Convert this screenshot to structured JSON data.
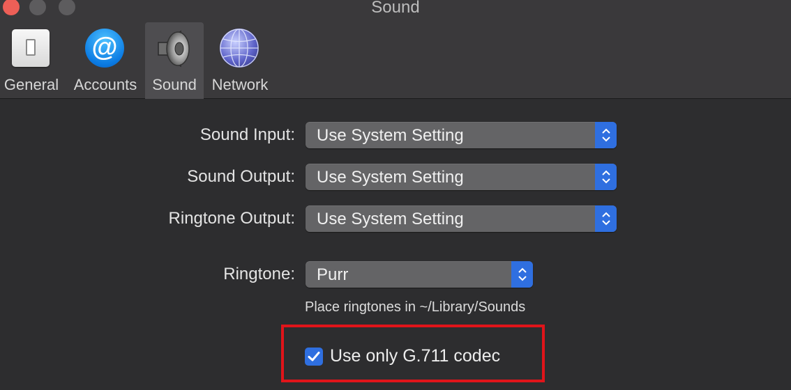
{
  "window": {
    "title": "Sound"
  },
  "toolbar": {
    "items": [
      {
        "label": "General",
        "icon": "general-icon",
        "selected": false
      },
      {
        "label": "Accounts",
        "icon": "accounts-icon",
        "selected": false
      },
      {
        "label": "Sound",
        "icon": "speaker-icon",
        "selected": true
      },
      {
        "label": "Network",
        "icon": "network-globe-icon",
        "selected": false
      }
    ]
  },
  "settings": {
    "sound_input": {
      "label": "Sound Input:",
      "value": "Use System Setting"
    },
    "sound_output": {
      "label": "Sound Output:",
      "value": "Use System Setting"
    },
    "ringtone_output": {
      "label": "Ringtone Output:",
      "value": "Use System Setting"
    },
    "ringtone": {
      "label": "Ringtone:",
      "value": "Purr"
    },
    "ringtone_hint": "Place ringtones in ~/Library/Sounds",
    "codec_checkbox": {
      "label": "Use only G.711 codec",
      "checked": true
    }
  },
  "colors": {
    "accent": "#2f6fe0",
    "highlight_border": "#e0141a",
    "window_bg": "#2d2d2f",
    "toolbar_bg": "#3a393b"
  }
}
